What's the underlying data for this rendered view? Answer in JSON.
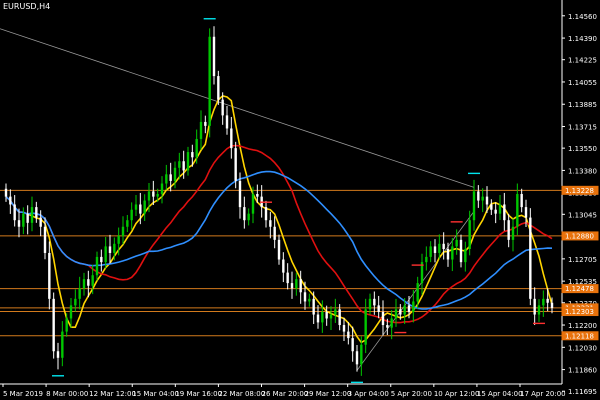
{
  "window": {
    "symbol_title": "EURUSD,H4"
  },
  "colors": {
    "background": "#000000",
    "axis": "#ffffff",
    "bull_candle": "#00c800",
    "bear_candle": "#ffffff",
    "ma_fast": "#ffd500",
    "ma_mid": "#e01010",
    "ma_slow": "#2f8fff",
    "horizontal_level": "#d27a1c",
    "trendline": "#9a9a9a",
    "level_tag_bg": "#e8720c",
    "level_tag_text": "#ffffff",
    "mark_cyan": "#00e5ee",
    "mark_red": "#ff3030"
  },
  "price_axis": {
    "min": 1.1175,
    "max": 1.1465,
    "tick_labels": [
      "1.14560",
      "1.14390",
      "1.14225",
      "1.14055",
      "1.13885",
      "1.13715",
      "1.13550",
      "1.13380",
      "1.13210",
      "1.13045",
      "1.12875",
      "1.12705",
      "1.12535",
      "1.12370",
      "1.12200",
      "1.12030",
      "1.11860",
      "1.11695"
    ],
    "level_tags": [
      "1.13228",
      "1.12880",
      "1.12478",
      "1.12331",
      "1.12303",
      "1.12118"
    ]
  },
  "time_axis": {
    "tick_labels": [
      "5 Mar 2019",
      "8 Mar 00:00",
      "12 Mar 12:00",
      "15 Mar 04:00",
      "19 Mar 16:00",
      "22 Mar 08:00",
      "26 Mar 20:00",
      "29 Mar 12:00",
      "3 Apr 04:00",
      "5 Apr 20:00",
      "10 Apr 12:00",
      "15 Apr 04:00",
      "17 Apr 20:00"
    ]
  },
  "chart_data": {
    "type": "candlestick",
    "title": "EURUSD,H4",
    "ylim": [
      1.1175,
      1.1465
    ],
    "horizontal_levels": [
      1.13228,
      1.1288,
      1.12478,
      1.12331,
      1.12303,
      1.12118
    ],
    "closes": [
      1.1318,
      1.1312,
      1.13,
      1.1295,
      1.1305,
      1.1298,
      1.131,
      1.1302,
      1.1295,
      1.1275,
      1.124,
      1.12,
      1.1195,
      1.1215,
      1.1225,
      1.1235,
      1.124,
      1.1248,
      1.1255,
      1.125,
      1.1258,
      1.1272,
      1.1268,
      1.128,
      1.1275,
      1.1282,
      1.1288,
      1.1295,
      1.13,
      1.1308,
      1.1312,
      1.1305,
      1.1315,
      1.1322,
      1.1318,
      1.132,
      1.1328,
      1.1335,
      1.133,
      1.134,
      1.1345,
      1.1338,
      1.1352,
      1.1348,
      1.1362,
      1.1375,
      1.1372,
      1.144,
      1.141,
      1.1392,
      1.138,
      1.137,
      1.1355,
      1.133,
      1.131,
      1.13,
      1.1305,
      1.132,
      1.1318,
      1.131,
      1.13,
      1.1295,
      1.1285,
      1.127,
      1.126,
      1.1252,
      1.1248,
      1.1255,
      1.1245,
      1.1238,
      1.124,
      1.1228,
      1.1222,
      1.123,
      1.1225,
      1.1228,
      1.1232,
      1.122,
      1.1215,
      1.121,
      1.12,
      1.119,
      1.1205,
      1.1232,
      1.124,
      1.1235,
      1.123,
      1.122,
      1.1218,
      1.1225,
      1.1232,
      1.1228,
      1.1235,
      1.123,
      1.1238,
      1.1252,
      1.1268,
      1.1272,
      1.128,
      1.1275,
      1.1282,
      1.1278,
      1.127,
      1.128,
      1.1285,
      1.1268,
      1.1278,
      1.13,
      1.1322,
      1.1315,
      1.1318,
      1.1312,
      1.1308,
      1.1305,
      1.1312,
      1.13,
      1.1285,
      1.1295,
      1.132,
      1.131,
      1.1302,
      1.124,
      1.1228,
      1.1235,
      1.124,
      1.1237,
      1.1233
    ]
  }
}
